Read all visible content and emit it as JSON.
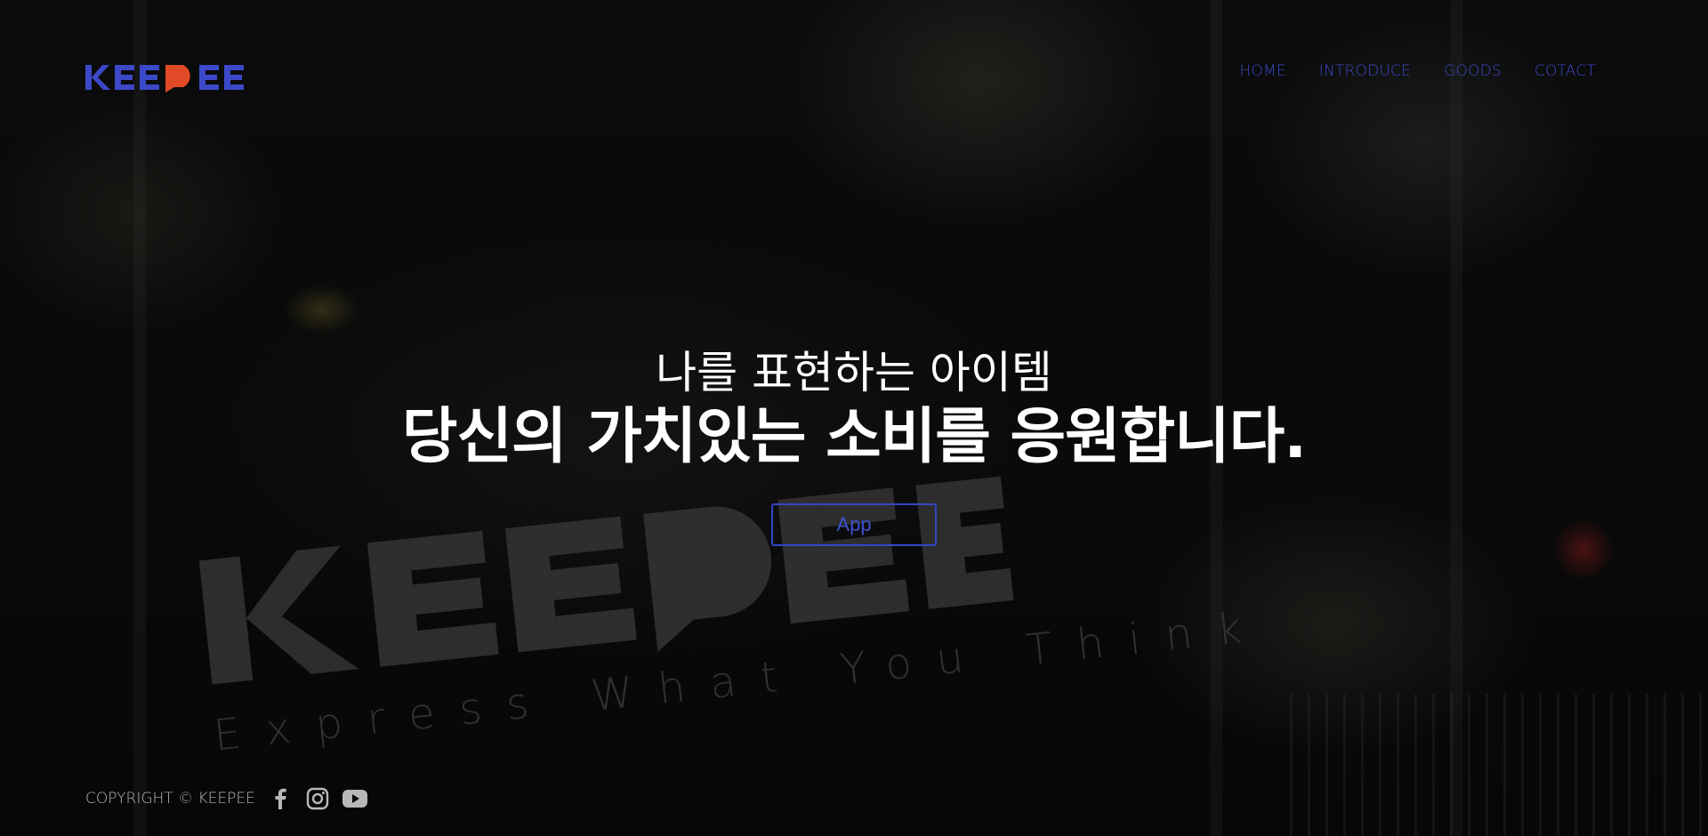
{
  "brand": {
    "logo_text": "KEEPEE",
    "watermark_text": "KEEPEE",
    "watermark_tagline": "Express What You Think",
    "colors": {
      "primary": "#3b49c8",
      "accent": "#e04a26"
    }
  },
  "nav": {
    "items": [
      {
        "label": "HOME"
      },
      {
        "label": "INTRODUCE"
      },
      {
        "label": "GOODS"
      },
      {
        "label": "COTACT"
      }
    ]
  },
  "hero": {
    "subtitle": "나를 표현하는 아이템",
    "headline": "당신의 가치있는 소비를 응원합니다.",
    "button_label": "App"
  },
  "footer": {
    "copyright": "COPYRIGHT © KEEPEE",
    "social_icons": [
      "facebook-icon",
      "instagram-icon",
      "youtube-icon"
    ]
  }
}
